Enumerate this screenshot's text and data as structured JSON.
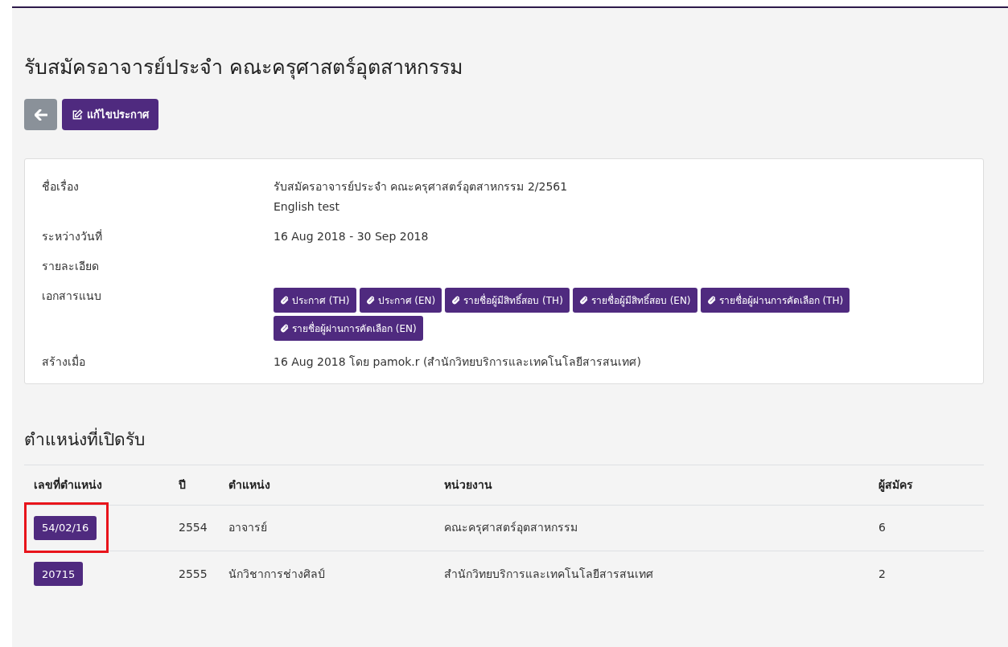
{
  "title": "รับสมัครอาจารย์ประจำ คณะครุศาสตร์อุตสาหกรรม",
  "toolbar": {
    "edit_button": "แก้ไขประกาศ"
  },
  "details": [
    {
      "kind": "text",
      "label": "ชื่อเรื่อง",
      "lines": [
        "รับสมัครอาจารย์ประจำ คณะครุศาสตร์อุตสาหกรรม 2/2561",
        "English test"
      ]
    },
    {
      "kind": "text",
      "label": "ระหว่างวันที่",
      "lines": [
        "16 Aug 2018 - 30 Sep 2018"
      ]
    },
    {
      "kind": "text",
      "label": "รายละเอียด"
    },
    {
      "kind": "attachments",
      "label": "เอกสารแนบ",
      "files": [
        "ประกาศ (TH)",
        "ประกาศ (EN)",
        "รายชื่อผู้มีสิทธิ์สอบ (TH)",
        "รายชื่อผู้มีสิทธิ์สอบ (EN)",
        "รายชื่อผู้ผ่านการคัดเลือก (TH)",
        "รายชื่อผู้ผ่านการคัดเลือก (EN)"
      ]
    },
    {
      "kind": "text",
      "label": "สร้างเมื่อ",
      "lines": [
        "16 Aug 2018 โดย pamok.r (สำนักวิทยบริการและเทคโนโลยีสารสนเทศ)"
      ]
    }
  ],
  "positions": {
    "heading": "ตำแหน่งที่เปิดรับ",
    "columns": [
      "เลขที่ตำแหน่ง",
      "ปี",
      "ตำแหน่ง",
      "หน่วยงาน",
      "ผู้สมัคร"
    ],
    "rows": [
      {
        "number": "54/02/16",
        "year": "2554",
        "position": "อาจารย์",
        "unit": "คณะครุศาสตร์อุตสาหกรรม",
        "applicants": "6",
        "highlighted": true
      },
      {
        "number": "20715",
        "year": "2555",
        "position": "นักวิชาการช่างศิลป์",
        "unit": "สำนักวิทยบริการและเทคโนโลยีสารสนเทศ",
        "applicants": "2",
        "highlighted": false
      }
    ]
  }
}
